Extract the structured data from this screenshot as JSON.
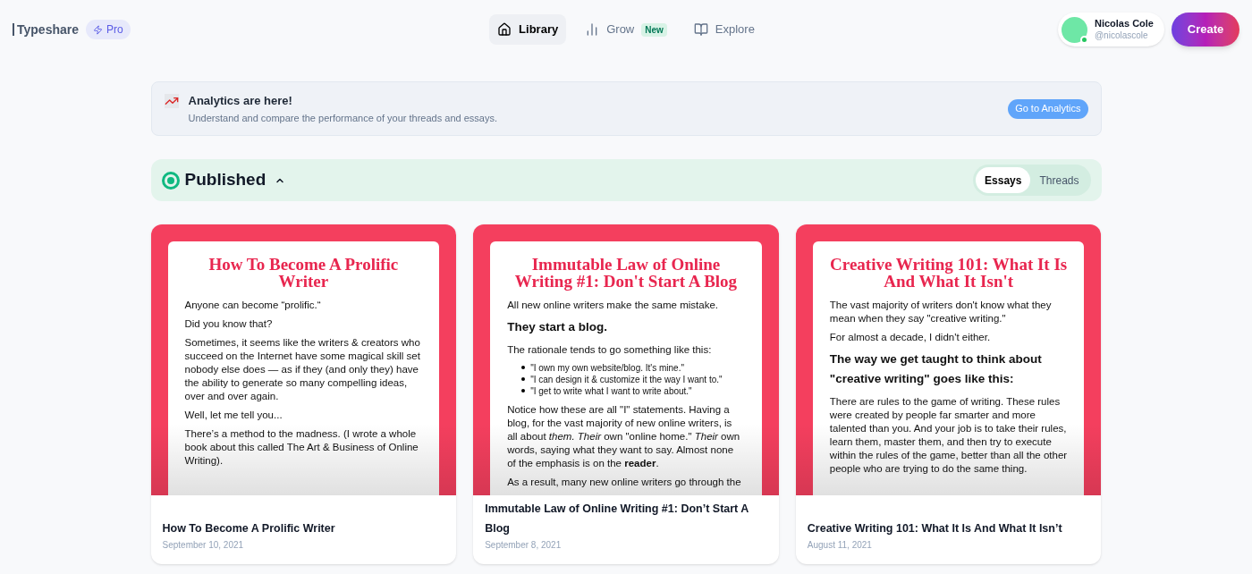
{
  "brand": {
    "name": "Typeshare",
    "plan": "Pro"
  },
  "nav": [
    {
      "label": "Library",
      "kind": "home",
      "selected": true
    },
    {
      "label": "Grow",
      "kind": "chart",
      "selected": false,
      "badge": "New"
    },
    {
      "label": "Explore",
      "kind": "book",
      "selected": false
    }
  ],
  "user": {
    "name": "Nicolas Cole",
    "handle": "@nicolascole",
    "online": true
  },
  "create_button": "Create",
  "banner": {
    "title": "Analytics are here!",
    "text": "Understand and compare the performance of your threads and essays.",
    "button": "Go to Analytics"
  },
  "section": {
    "title": "Published",
    "expanded": true,
    "toggle": [
      {
        "label": "Essays",
        "selected": true
      },
      {
        "label": "Threads",
        "selected": false
      }
    ]
  },
  "cards": [
    {
      "preview_title": "How To Become A Prolific Writer",
      "blocks": [
        {
          "kind": "p",
          "text": "Anyone can become “prolific.“"
        },
        {
          "kind": "p",
          "text": "Did you know that?"
        },
        {
          "kind": "p",
          "text": "Sometimes, it seems like the writers & creators who succeed on the Internet have some magical skill set nobody else does — as if they (and only they) have the ability to generate so many compelling ideas, over and over again."
        },
        {
          "kind": "p",
          "text": "Well, let me tell you..."
        },
        {
          "kind": "p",
          "text": "There’s a method to the madness. (I wrote a whole book about this called The Art & Business of Online Writing)."
        }
      ],
      "title": "How To Become A Prolific Writer",
      "date": "September 10, 2021"
    },
    {
      "preview_title": "Immutable Law of Online Writing #1: Don't Start A Blog",
      "blocks": [
        {
          "kind": "p",
          "text": "All new online writers make the same mistake."
        },
        {
          "kind": "h",
          "text": "They start a blog."
        },
        {
          "kind": "p",
          "text": "The rationale tends to go something like this:"
        },
        {
          "kind": "ul",
          "items": [
            "\"I own my own website/blog. It's mine.\"",
            "\"I can design it & customize it the way I want to.\"",
            "\"I get to write what I want to write about.\""
          ]
        },
        {
          "kind": "p",
          "text": "Notice how these are all \"I\" statements. Having a blog, for the vast majority of new online writers, is all about *them.* *Their* own \"online home.\" *Their* own words, saying what they want to say. Almost none of the emphasis is on the **reader**."
        },
        {
          "kind": "p",
          "text": "As a result, many new online writers go through the"
        }
      ],
      "title": "Immutable Law of Online Writing #1: Don’t Start A Blog",
      "date": "September 8, 2021"
    },
    {
      "preview_title": "Creative Writing 101: What It Is And What It Isn't",
      "blocks": [
        {
          "kind": "p",
          "text": "The vast majority of writers don't know what they mean when they say \"creative writing.\""
        },
        {
          "kind": "p",
          "text": "For almost a decade, I didn't either."
        },
        {
          "kind": "h",
          "text": "The way we get taught to think about \"creative writing\" goes like this:"
        },
        {
          "kind": "p",
          "text": "There are rules to the game of writing. These rules were created by people far smarter and more talented than you. And your job is to take their rules, learn them, master them, and then try to execute within the rules of the game, better than all the other people who are trying to do the same thing."
        }
      ],
      "title": "Creative Writing 101: What It Is And What It Isn’t",
      "date": "August 11, 2021"
    }
  ]
}
